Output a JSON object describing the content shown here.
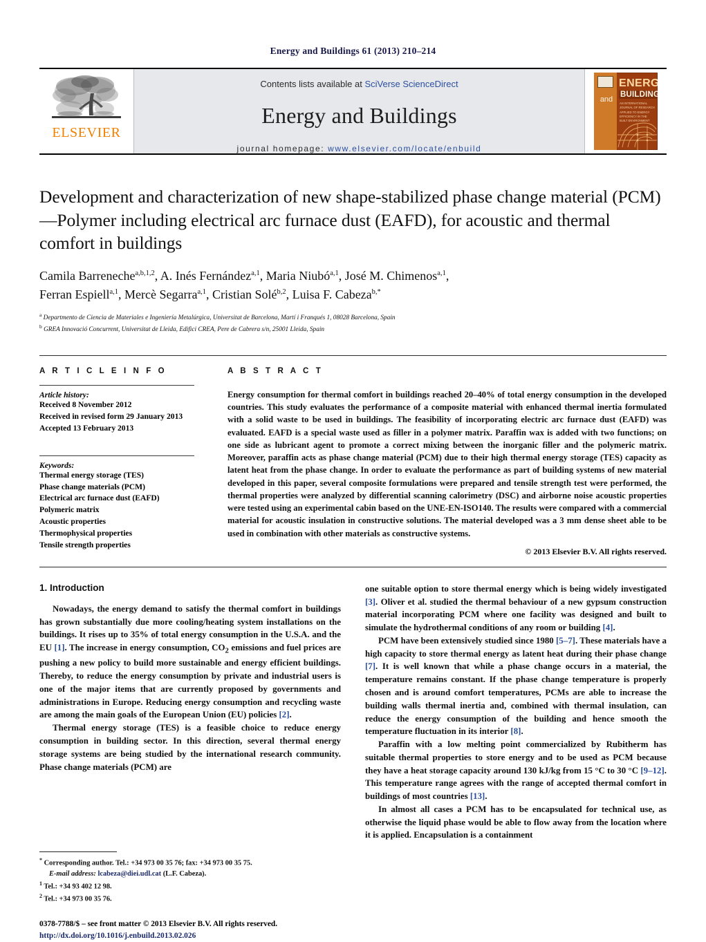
{
  "running_head": "Energy and Buildings 61 (2013) 210–214",
  "masthead": {
    "publisher_name": "ELSEVIER",
    "contents_prefix": "Contents lists available at ",
    "contents_link": "SciVerse ScienceDirect",
    "journal_name": "Energy and Buildings",
    "homepage_label": "journal homepage:",
    "homepage_url": "www.elsevier.com/locate/enbuild",
    "cover": {
      "and": "and",
      "energy": "ENERGY",
      "buildings": "BUILDINGS",
      "subtitle": "AN INTERNATIONAL JOURNAL OF RESEARCH APPLIED TO ENERGY EFFICIENCY IN THE BUILT ENVIRONMENT"
    }
  },
  "article": {
    "title": "Development and characterization of new shape-stabilized phase change material (PCM)—Polymer including electrical arc furnace dust (EAFD), for acoustic and thermal comfort in buildings",
    "authors_line_1": "Camila Barreneche",
    "authors_line_1_sup": "a,b,1,2",
    "authors": [
      {
        "name": "Camila Barreneche",
        "sup": "a,b,1,2"
      },
      {
        "name": "A. Inés Fernández",
        "sup": "a,1"
      },
      {
        "name": "Maria Niubó",
        "sup": "a,1"
      },
      {
        "name": "José M. Chimenos",
        "sup": "a,1"
      },
      {
        "name": "Ferran Espiell",
        "sup": "a,1"
      },
      {
        "name": "Mercè Segarra",
        "sup": "a,1"
      },
      {
        "name": "Cristian Solé",
        "sup": "b,2"
      },
      {
        "name": "Luisa F. Cabeza",
        "sup": "b,*"
      }
    ],
    "affiliations": [
      {
        "marker": "a",
        "text": "Departmento de Ciencia de Materiales e Ingeniería Metalúrgica, Universitat de Barcelona, Martí i Franqués 1, 08028 Barcelona, Spain"
      },
      {
        "marker": "b",
        "text": "GREA Innovació Concurrent, Universitat de Lleida, Edifici CREA, Pere de Cabrera s/n, 25001 Lleida, Spain"
      }
    ]
  },
  "article_info": {
    "heading": "A R T I C L E    I N F O",
    "history_label": "Article history:",
    "history": [
      "Received 8 November 2012",
      "Received in revised form 29 January 2013",
      "Accepted 13 February 2013"
    ],
    "keywords_label": "Keywords:",
    "keywords": [
      "Thermal energy storage (TES)",
      "Phase change materials (PCM)",
      "Electrical arc furnace dust (EAFD)",
      "Polymeric matrix",
      "Acoustic properties",
      "Thermophysical properties",
      "Tensile strength properties"
    ]
  },
  "abstract": {
    "heading": "A B S T R A C T",
    "text": "Energy consumption for thermal comfort in buildings reached 20–40% of total energy consumption in the developed countries. This study evaluates the performance of a composite material with enhanced thermal inertia formulated with a solid waste to be used in buildings. The feasibility of incorporating electric arc furnace dust (EAFD) was evaluated. EAFD is a special waste used as filler in a polymer matrix. Paraffin wax is added with two functions; on one side as lubricant agent to promote a correct mixing between the inorganic filler and the polymeric matrix. Moreover, paraffin acts as phase change material (PCM) due to their high thermal energy storage (TES) capacity as latent heat from the phase change. In order to evaluate the performance as part of building systems of new material developed in this paper, several composite formulations were prepared and tensile strength test were performed, the thermal properties were analyzed by differential scanning calorimetry (DSC) and airborne noise acoustic properties were tested using an experimental cabin based on the UNE-EN-ISO140. The results were compared with a commercial material for acoustic insulation in constructive solutions. The material developed was a 3 mm dense sheet able to be used in combination with other materials as constructive systems.",
    "copyright": "© 2013 Elsevier B.V. All rights reserved."
  },
  "introduction": {
    "heading": "1.  Introduction",
    "left_paragraphs": [
      "Nowadays, the energy demand to satisfy the thermal comfort in buildings has grown substantially due more cooling/heating system installations on the buildings. It rises up to 35% of total energy consumption in the U.S.A. and the EU [1]. The increase in energy consumption, CO2 emissions and fuel prices are pushing a new policy to build more sustainable and energy efficient buildings. Thereby, to reduce the energy consumption by private and industrial users is one of the major items that are currently proposed by governments and administrations in Europe. Reducing energy consumption and recycling waste are among the main goals of the European Union (EU) policies [2].",
      "Thermal energy storage (TES) is a feasible choice to reduce energy consumption in building sector. In this direction, several thermal energy storage systems are being studied by the international research community. Phase change materials (PCM) are"
    ],
    "right_paragraphs": [
      "one suitable option to store thermal energy which is being widely investigated [3]. Oliver et al. studied the thermal behaviour of a new gypsum construction material incorporating PCM where one facility was designed and built to simulate the hydrothermal conditions of any room or building [4].",
      "PCM have been extensively studied since 1980 [5–7]. These materials have a high capacity to store thermal energy as latent heat during their phase change [7]. It is well known that while a phase change occurs in a material, the temperature remains constant. If the phase change temperature is properly chosen and is around comfort temperatures, PCMs are able to increase the building walls thermal inertia and, combined with thermal insulation, can reduce the energy consumption of the building and hence smooth the temperature fluctuation in its interior [8].",
      "Paraffin with a low melting point commercialized by Rubitherm has suitable thermal properties to store energy and to be used as PCM because they have a heat storage capacity around 130 kJ/kg from 15 °C to 30 °C [9–12]. This temperature range agrees with the range of accepted thermal comfort in buildings of most countries [13].",
      "In almost all cases a PCM has to be encapsulated for technical use, as otherwise the liquid phase would be able to flow away from the location where it is applied. Encapsulation is a containment"
    ]
  },
  "footnotes": {
    "corresponding": "Corresponding author. Tel.: +34 973 00 35 76; fax: +34 973 00 35 75.",
    "email_label": "E-mail address:",
    "email": "lcabeza@diei.udl.cat",
    "email_suffix": "(L.F. Cabeza).",
    "tel1": "Tel.: +34 93 402 12 98.",
    "tel2": "Tel.: +34 973 00 35 76.",
    "issn_line": "0378-7788/$ – see front matter © 2013 Elsevier B.V. All rights reserved.",
    "doi": "http://dx.doi.org/10.1016/j.enbuild.2013.02.026"
  },
  "colors": {
    "link_blue": "#2b4f9e",
    "elsevier_orange": "#f08000",
    "cover_orange": "#cf7a28",
    "cover_brown": "#9c3d10",
    "band_grey": "#e7e8ec"
  }
}
